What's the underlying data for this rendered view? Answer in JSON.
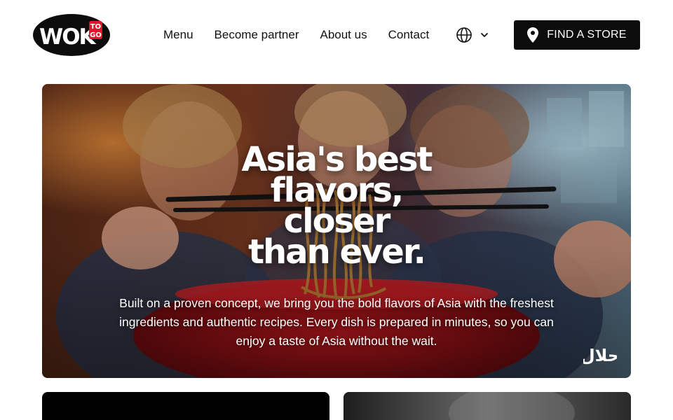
{
  "brand": {
    "logo_main": "WOK",
    "logo_badge_top": "TO",
    "logo_badge_bottom": "GO",
    "accent": "#e3142d"
  },
  "nav": {
    "items": [
      "Menu",
      "Become partner",
      "About us",
      "Contact"
    ]
  },
  "language": {
    "icon": "globe-icon",
    "caret": "chevron-down-icon"
  },
  "cta": {
    "label": "FIND A STORE",
    "icon": "map-pin-icon"
  },
  "hero": {
    "title_lines": [
      "Asia's best",
      "flavors,",
      "closer",
      "than ever."
    ],
    "body": "Built on a proven concept, we bring you the bold flavors of Asia with the freshest ingredients and authentic recipes. Every dish is prepared in minutes, so you can enjoy a taste of Asia without the wait.",
    "badge_icon": "halal-icon",
    "badge_text": "حلال"
  },
  "colors": {
    "header_bg": "#ffffff",
    "button_bg": "#0c0c0c",
    "text": "#111111"
  }
}
